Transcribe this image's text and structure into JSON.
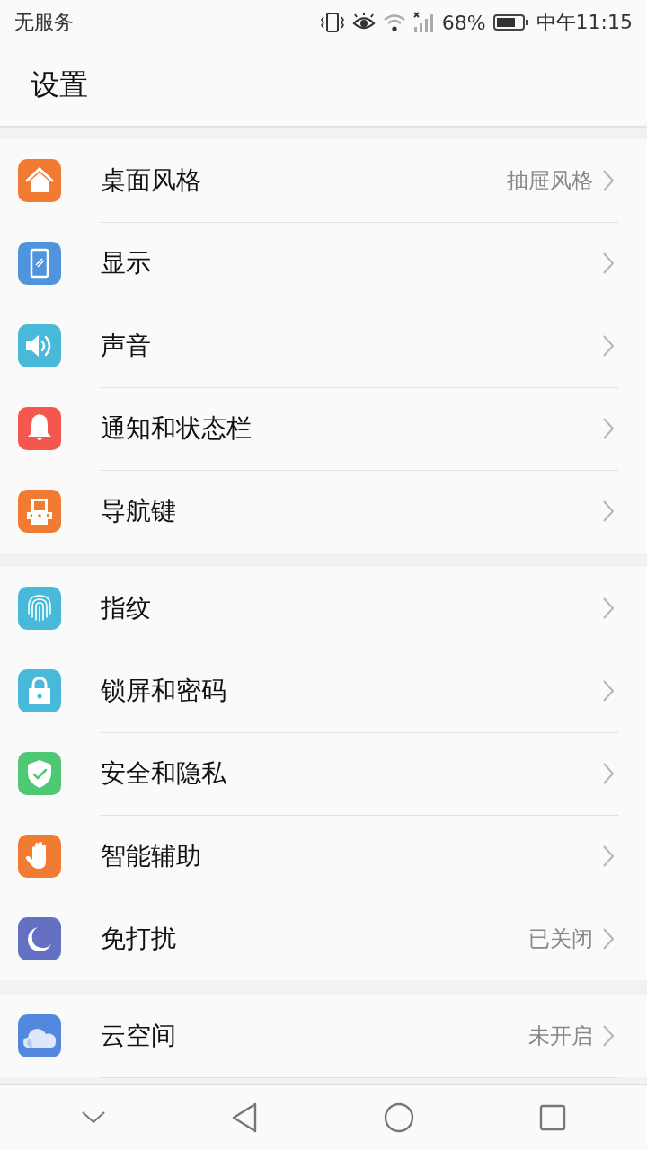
{
  "status_bar": {
    "carrier": "无服务",
    "battery_percent": "68%",
    "time": "中午11:15"
  },
  "header": {
    "title": "设置"
  },
  "groups": [
    {
      "items": [
        {
          "label": "桌面风格",
          "value": "抽屉风格",
          "color": "#f27b33"
        },
        {
          "label": "显示",
          "color": "#5094db"
        },
        {
          "label": "声音",
          "color": "#48b9d9"
        },
        {
          "label": "通知和状态栏",
          "color": "#f4574e"
        },
        {
          "label": "导航键",
          "color": "#f27b33"
        }
      ]
    },
    {
      "items": [
        {
          "label": "指纹",
          "color": "#48b9d9"
        },
        {
          "label": "锁屏和密码",
          "color": "#48b9d9"
        },
        {
          "label": "安全和隐私",
          "color": "#4ec872"
        },
        {
          "label": "智能辅助",
          "color": "#f27b33"
        },
        {
          "label": "免打扰",
          "value": "已关闭",
          "color": "#6470c2"
        }
      ]
    },
    {
      "items": [
        {
          "label": "云空间",
          "value": "未开启",
          "color": "#5289de"
        }
      ]
    }
  ]
}
